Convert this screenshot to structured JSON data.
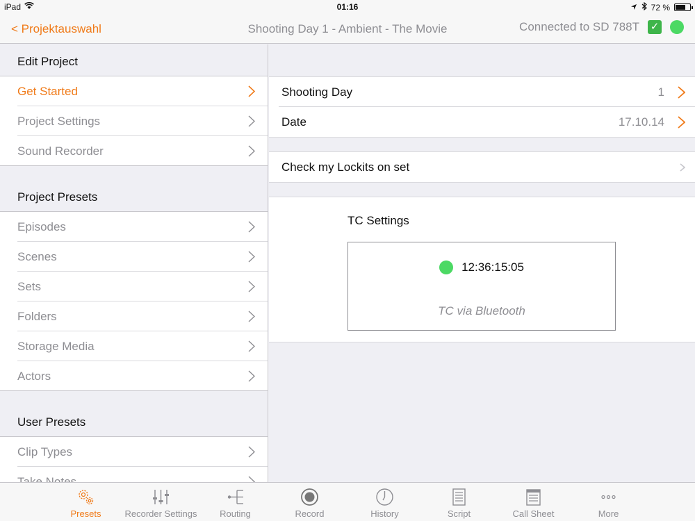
{
  "status_bar": {
    "device": "iPad",
    "time": "01:16",
    "battery": "72 %",
    "battery_level": 0.72
  },
  "nav": {
    "back_label": "< Projektauswahl",
    "title": "Shooting Day 1 - Ambient - The Movie",
    "connection": "Connected to SD 788T",
    "check_mark": "✓",
    "status_color": "#4cd964"
  },
  "sidebar": {
    "sections": [
      {
        "title": "Edit Project",
        "items": [
          "Get Started",
          "Project Settings",
          "Sound Recorder"
        ]
      },
      {
        "title": "Project Presets",
        "items": [
          "Episodes",
          "Scenes",
          "Sets",
          "Folders",
          "Storage Media",
          "Actors"
        ]
      },
      {
        "title": "User Presets",
        "items": [
          "Clip Types",
          "Take Notes"
        ]
      }
    ],
    "active_item": "Get Started"
  },
  "main": {
    "shooting_day_label": "Shooting Day",
    "shooting_day_value": "1",
    "date_label": "Date",
    "date_value": "17.10.14",
    "lockits_label": "Check my Lockits on set",
    "tc": {
      "title": "TC Settings",
      "timecode": "12:36:15:05",
      "source": "TC via Bluetooth"
    }
  },
  "tabbar": {
    "tabs": [
      {
        "label": "Presets",
        "icon": "gears-icon"
      },
      {
        "label": "Recorder Settings",
        "icon": "sliders-icon"
      },
      {
        "label": "Routing",
        "icon": "routing-icon"
      },
      {
        "label": "Record",
        "icon": "record-icon"
      },
      {
        "label": "History",
        "icon": "clock-icon"
      },
      {
        "label": "Script",
        "icon": "script-icon"
      },
      {
        "label": "Call Sheet",
        "icon": "call-sheet-icon"
      },
      {
        "label": "More",
        "icon": "more-icon"
      }
    ],
    "active": "Presets"
  },
  "colors": {
    "accent": "#f07b1a",
    "green": "#4cd964",
    "gray_text": "#8e8e93"
  }
}
